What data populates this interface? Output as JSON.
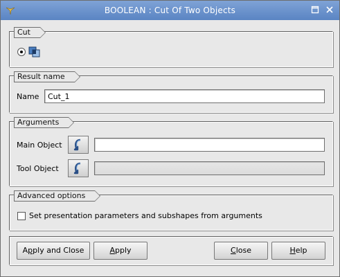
{
  "window": {
    "title": "BOOLEAN : Cut Of Two Objects",
    "app_icon": "yellow-sketch-icon",
    "buttons": [
      "restore",
      "close"
    ]
  },
  "operation_group": {
    "label": "Cut",
    "selected_option": "cut-operation-icon"
  },
  "result_group": {
    "label": "Result name",
    "name_label": "Name",
    "name_value": "Cut_1"
  },
  "arguments_group": {
    "label": "Arguments",
    "main_object_label": "Main Object",
    "main_object_value": "",
    "tool_object_label": "Tool Object",
    "tool_object_value": ""
  },
  "advanced_group": {
    "label": "Advanced options",
    "checkbox_label": "Set presentation parameters and subshapes from arguments",
    "checked": false
  },
  "buttons": {
    "apply_close_pre": "A",
    "apply_close_mn": "p",
    "apply_close_post": "ply and Close",
    "apply_mn": "A",
    "apply_post": "pply",
    "close_mn": "C",
    "close_post": "lose",
    "help_mn": "H",
    "help_post": "elp"
  }
}
